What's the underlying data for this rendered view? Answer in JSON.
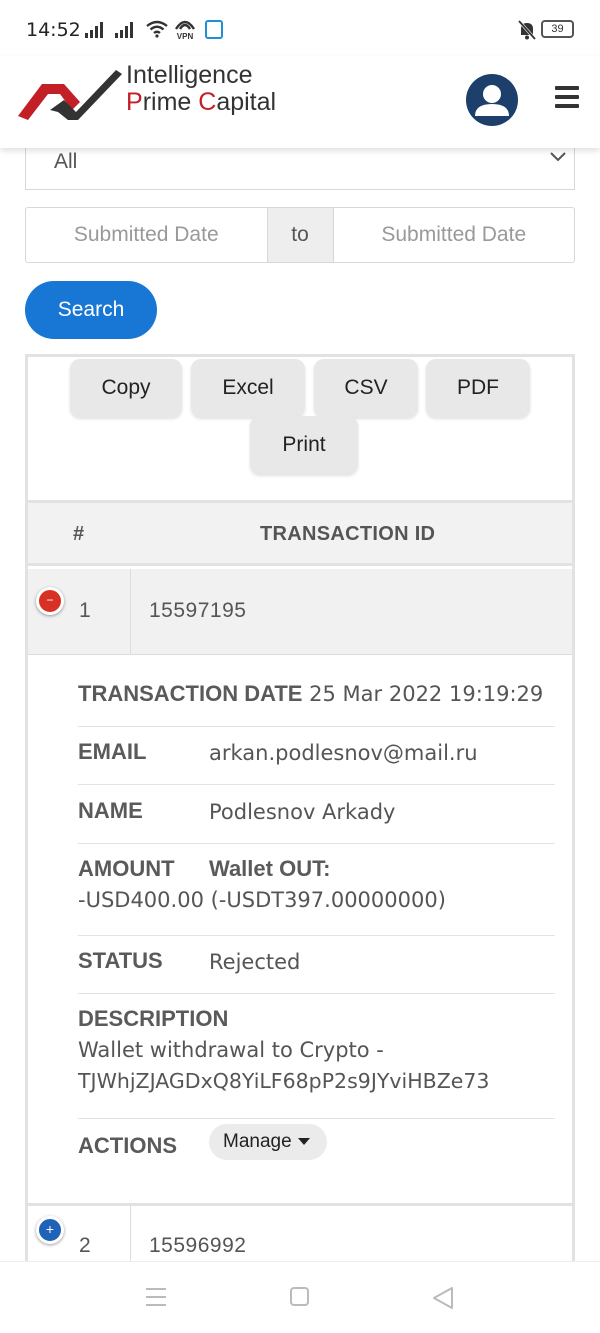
{
  "status_bar": {
    "time": "14:52",
    "vpn_label": "VPN",
    "battery": "39",
    "icons": [
      "signal-icon",
      "wifi-icon",
      "vpn-icon",
      "shield-icon",
      "bell-off-icon",
      "battery-icon"
    ]
  },
  "header": {
    "logo_line1": "Intelligence",
    "logo_prime_p": "P",
    "logo_prime_rest": "rime ",
    "logo_capital_c": "C",
    "logo_capital_rest": "apital",
    "brand_red": "#c21f26",
    "brand_dark": "#333333"
  },
  "filters": {
    "status_selected": "All",
    "date_from_placeholder": "Submitted Date",
    "date_to_label": "to",
    "date_to_placeholder": "Submitted Date",
    "search_label": "Search",
    "accent": "#1877d4"
  },
  "export_buttons": {
    "copy": "Copy",
    "excel": "Excel",
    "csv": "CSV",
    "pdf": "PDF",
    "print": "Print"
  },
  "table": {
    "col_number": "#",
    "col_transaction_id": "TRANSACTION ID",
    "rows": [
      {
        "number": "1",
        "transaction_id": "15597195",
        "toggle": "−",
        "details": {
          "date_label": "TRANSACTION DATE",
          "date_value": "25 Mar 2022 19:19:29",
          "email_label": "EMAIL",
          "email_value": "arkan.podlesnov@mail.ru",
          "name_label": "NAME",
          "name_value": "Podlesnov Arkady",
          "amount_label": "AMOUNT",
          "amount_type": "Wallet OUT:",
          "amount_value": "-USD400.00 (-USDT397.00000000)",
          "status_label": "STATUS",
          "status_value": "Rejected",
          "description_label": "DESCRIPTION",
          "description_line1": "Wallet withdrawal to Crypto -",
          "description_line2": "TJWhjZJAGDxQ8YiLF68pP2s9JYviHBZe73",
          "actions_label": "ACTIONS",
          "manage_label": "Manage"
        }
      },
      {
        "number": "2",
        "transaction_id": "15596992",
        "toggle": "+"
      }
    ]
  }
}
